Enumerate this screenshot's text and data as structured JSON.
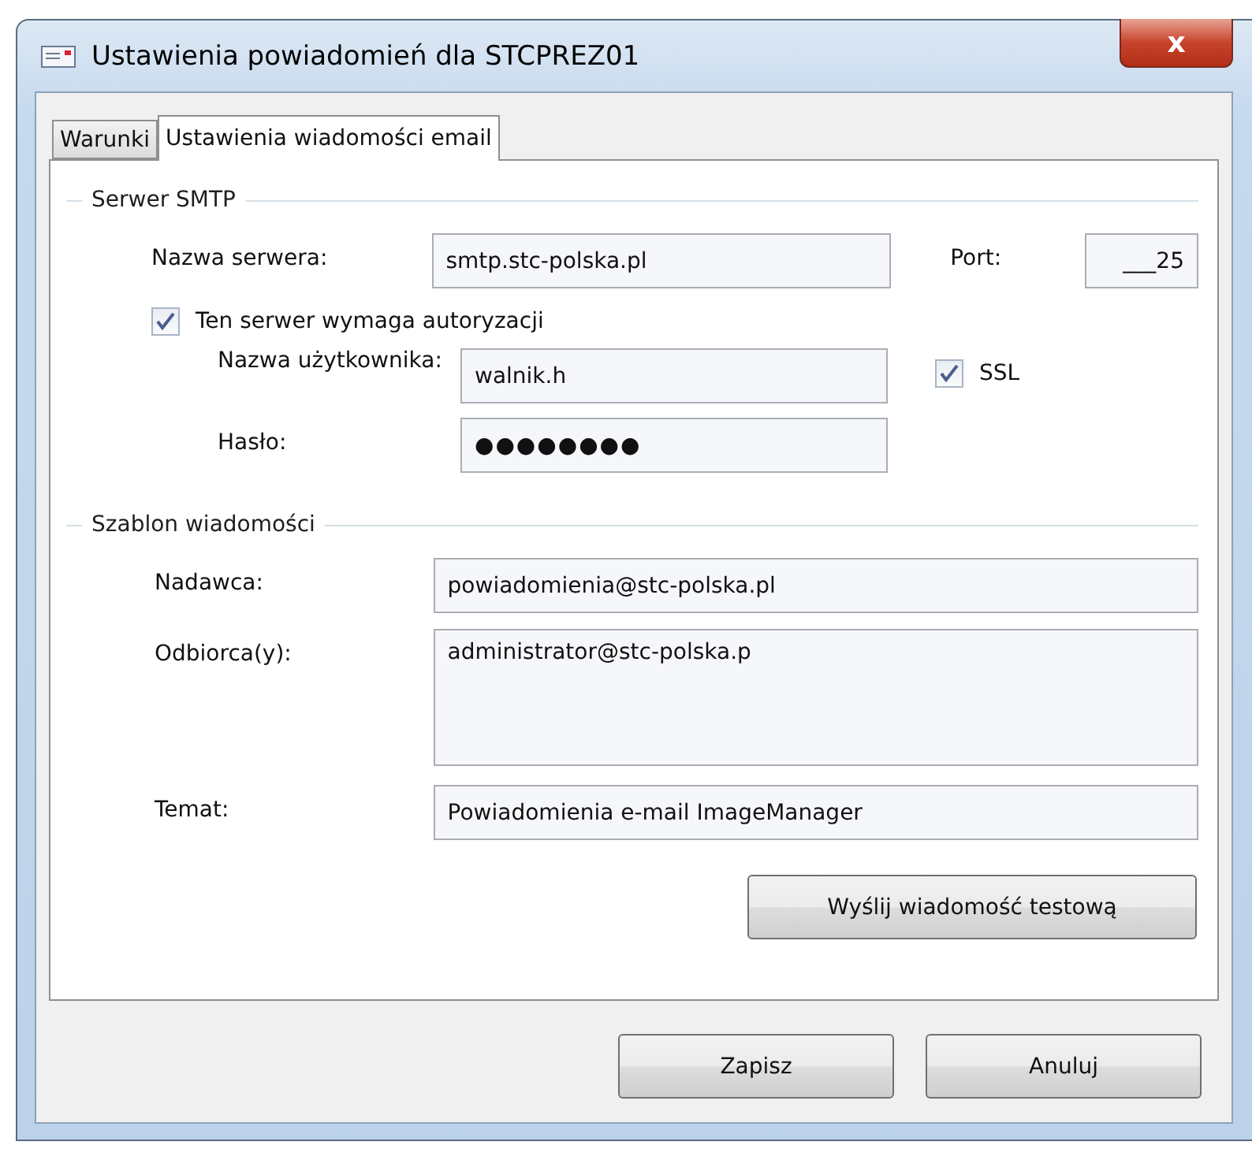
{
  "window": {
    "title": "Ustawienia powiadomień dla STCPREZ01",
    "close": "x"
  },
  "tabs": [
    {
      "label": "Warunki",
      "selected": false
    },
    {
      "label": "Ustawienia wiadomości email",
      "selected": true
    }
  ],
  "smtp": {
    "heading": "Serwer SMTP",
    "server_label": "Nazwa serwera:",
    "server": "smtp.stc-polska.pl",
    "port_label": "Port:",
    "port": "___25",
    "auth": {
      "label": "Ten serwer wymaga autoryzacji",
      "checked": true
    },
    "user_label": "Nazwa użytkownika:",
    "user": "walnik.h",
    "ssl": {
      "label": "SSL",
      "checked": true
    },
    "password_label": "Hasło:",
    "password": "●●●●●●●●"
  },
  "template": {
    "heading": "Szablon wiadomości",
    "sender_label": "Nadawca:",
    "sender": "powiadomienia@stc-polska.pl",
    "recipients_label": "Odbiorca(y):",
    "recipients": "administrator@stc-polska.p",
    "subject_label": "Temat:",
    "subject": "Powiadomienia e-mail ImageManager",
    "test_button": "Wyślij wiadomość testową"
  },
  "buttons": [
    "Zapisz",
    "Anuluj"
  ]
}
